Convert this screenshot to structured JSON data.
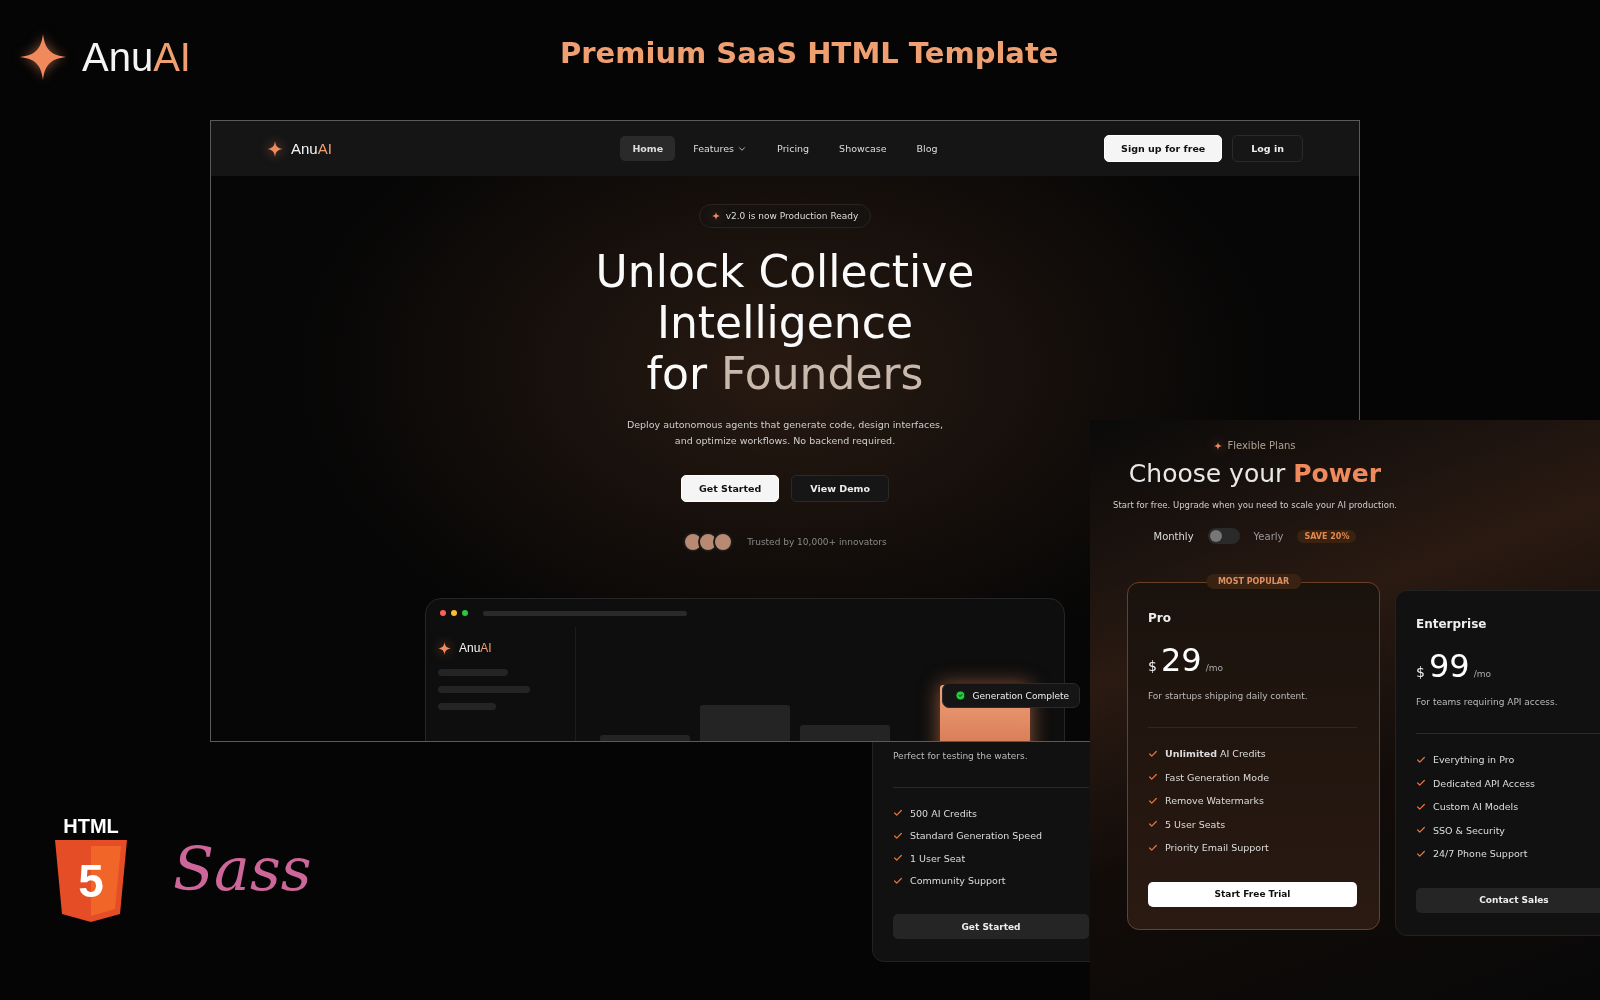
{
  "brand": {
    "name": "Anu",
    "accent": "AI"
  },
  "headline": "Premium SaaS HTML Template",
  "tech_logos": [
    {
      "kind": "html5",
      "label": "HTML",
      "mark": "5"
    },
    {
      "kind": "sass",
      "label": "Sass"
    }
  ],
  "landing_page": {
    "nav": {
      "brand": {
        "name": "Anu",
        "accent": "AI"
      },
      "links": [
        {
          "label": "Home",
          "selected": true,
          "dropdown": false
        },
        {
          "label": "Features",
          "selected": false,
          "dropdown": true
        },
        {
          "label": "Pricing",
          "selected": false,
          "dropdown": false
        },
        {
          "label": "Showcase",
          "selected": false,
          "dropdown": false
        },
        {
          "label": "Blog",
          "selected": false,
          "dropdown": false
        }
      ],
      "buttons": [
        {
          "label": "Sign up for free",
          "kind": "primary"
        },
        {
          "label": "Log in",
          "kind": "secondary"
        }
      ]
    },
    "announcement": "v2.0 is now Production Ready",
    "title_lines": [
      "Unlock Collective",
      "Intelligence"
    ],
    "title_last": {
      "lead": "for",
      "accent": "Founders"
    },
    "subtitle": "Deploy autonomous agents that generate code, design interfaces, and optimize workflows. No backend required.",
    "cta": [
      {
        "label": "Get Started",
        "kind": "primary"
      },
      {
        "label": "View Demo",
        "kind": "secondary"
      }
    ],
    "social_proof": "Trusted by 10,000+ innovators",
    "preview": {
      "brand": {
        "name": "Anu",
        "accent": "AI"
      },
      "toast": "Generation Complete"
    }
  },
  "pricing": {
    "eyebrow": "Flexible Plans",
    "title": "Choose your",
    "title_accent": "Power",
    "subtitle": "Start for free. Upgrade when you need to scale your AI production.",
    "billing": {
      "monthly": "Monthly",
      "yearly": "Yearly",
      "yearly_selected": false,
      "badge": "SAVE 20%"
    },
    "plans": [
      {
        "description": "Perfect for testing the waters.",
        "highlight": false,
        "features": [
          "500 AI Credits",
          "Standard Generation Speed",
          "1 User Seat",
          "Community Support"
        ],
        "button": {
          "label": "Get Started",
          "kind": "secondary"
        }
      },
      {
        "badge": "MOST POPULAR",
        "name": "Pro",
        "currency": "$",
        "price": "29",
        "period": "/mo",
        "description": "For startups shipping daily content.",
        "highlight": true,
        "features": [
          "**Unlimited** AI Credits",
          "Fast Generation Mode",
          "Remove Watermarks",
          "5 User Seats",
          "Priority Email Support"
        ],
        "button": {
          "label": "Start Free Trial",
          "kind": "primary"
        }
      },
      {
        "name": "Enterprise",
        "currency": "$",
        "price": "99",
        "period": "/mo",
        "description": "For teams requiring API access.",
        "highlight": false,
        "features": [
          "Everything in Pro",
          "Dedicated API Access",
          "Custom AI Models",
          "SSO & Security",
          "24/7 Phone Support"
        ],
        "button": {
          "label": "Contact Sales",
          "kind": "secondary"
        }
      }
    ]
  }
}
